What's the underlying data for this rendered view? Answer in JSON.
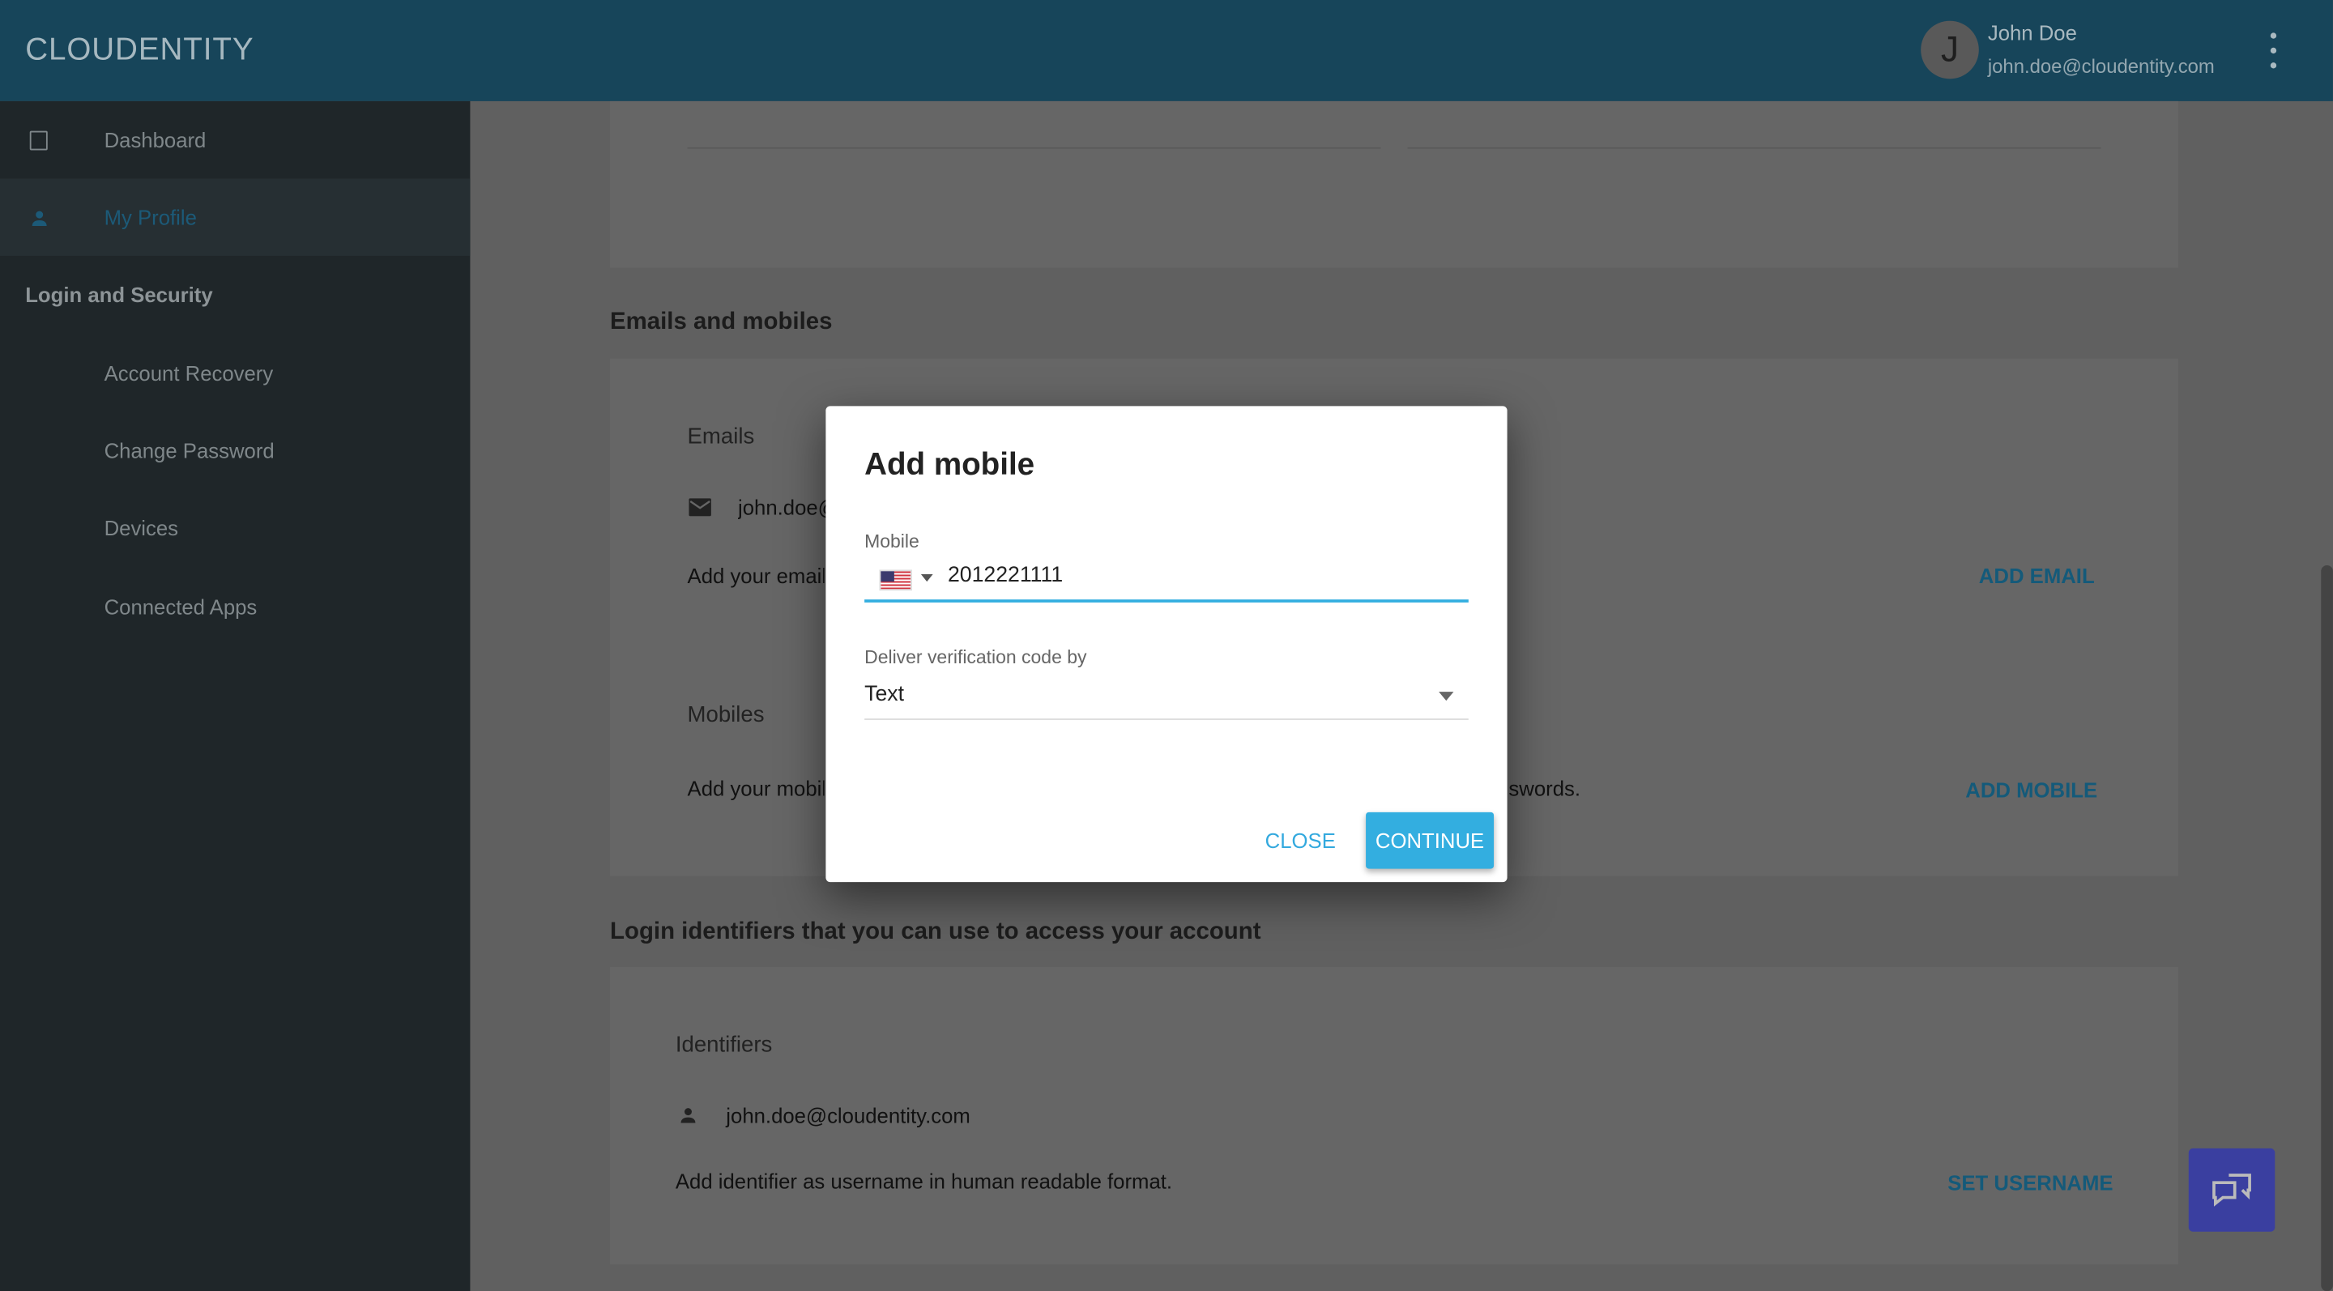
{
  "header": {
    "logo": "CLOUDENTITY",
    "avatar_initial": "J",
    "user_name": "John Doe",
    "user_email": "john.doe@cloudentity.com"
  },
  "sidebar": {
    "items": [
      {
        "label": "Dashboard",
        "icon": "tablet-icon"
      },
      {
        "label": "My Profile",
        "icon": "person-icon",
        "active": true
      }
    ],
    "section": "Login and Security",
    "sub_items": [
      {
        "label": "Account Recovery"
      },
      {
        "label": "Change Password"
      },
      {
        "label": "Devices"
      },
      {
        "label": "Connected Apps"
      }
    ]
  },
  "main": {
    "emails_section": {
      "title": "Emails and mobiles",
      "emails_heading": "Emails",
      "email": "john.doe@cloudentity.com",
      "email_hint": "Add your email",
      "add_email": "ADD EMAIL",
      "mobiles_heading": "Mobiles",
      "mobile_hint": "Add your mobile",
      "mobile_hint_tail": "swords.",
      "add_mobile": "ADD MOBILE"
    },
    "identifiers_section": {
      "title": "Login identifiers that you can use to access your account",
      "heading": "Identifiers",
      "identifier": "john.doe@cloudentity.com",
      "hint": "Add identifier as username in human readable format.",
      "set_username": "SET USERNAME"
    }
  },
  "dialog": {
    "title": "Add mobile",
    "mobile_label": "Mobile",
    "country": "US",
    "mobile_value": "2012221111",
    "deliver_label": "Deliver verification code by",
    "deliver_value": "Text",
    "close": "CLOSE",
    "continue": "CONTINUE"
  },
  "colors": {
    "accent": "#33aee0",
    "header": "#37a9dc",
    "chat_button": "#5a60e6"
  }
}
